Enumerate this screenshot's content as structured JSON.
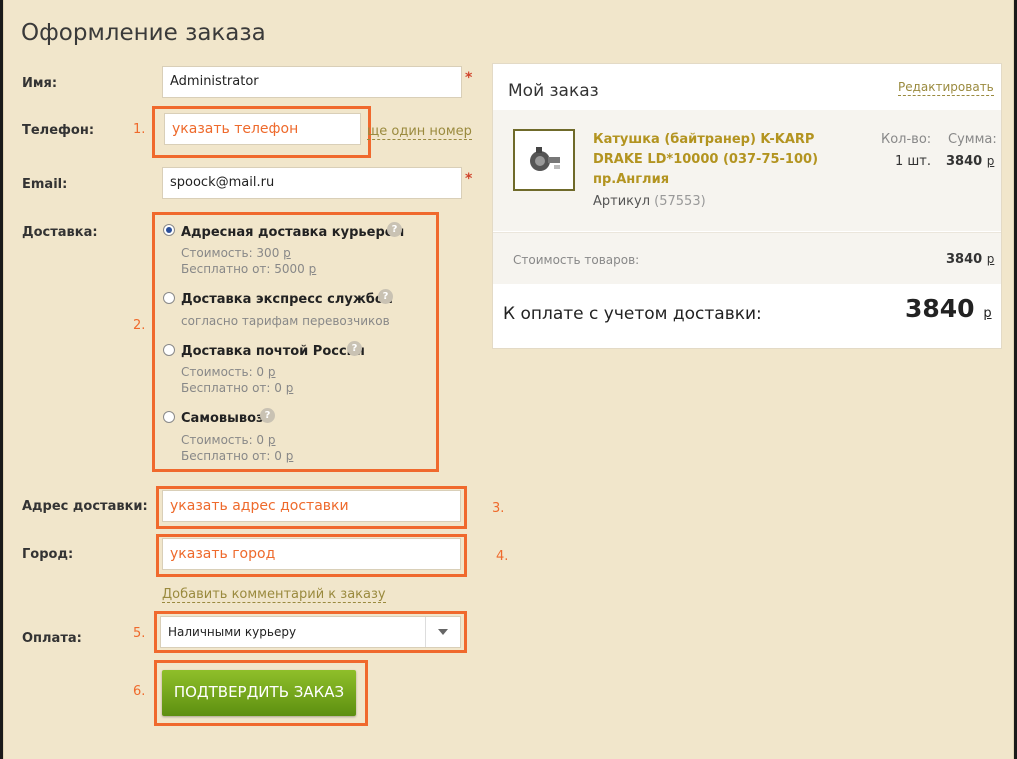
{
  "page_title": "Оформление заказа",
  "form": {
    "name_label": "Имя:",
    "name_value": "Administrator",
    "required_mark": "*",
    "phone_label": "Телефон:",
    "phone_placeholder": "указать телефон",
    "phone_extra_link": "ще один номер",
    "email_label": "Email:",
    "email_value": "spoock@mail.ru",
    "delivery_label": "Доставка:",
    "delivery_options": [
      {
        "title": "Адресная доставка курьером",
        "line1": "Стоимость: 300",
        "line2": "Бесплатно от: 5000",
        "selected": true
      },
      {
        "title": "Доставка экспресс службой",
        "line1": "согласно тарифам перевозчиков",
        "line2": "",
        "selected": false
      },
      {
        "title": "Доставка почтой России",
        "line1": "Стоимость: 0",
        "line2": "Бесплатно от: 0",
        "selected": false
      },
      {
        "title": "Самовывоз",
        "line1": "Стоимость: 0",
        "line2": "Бесплатно от: 0",
        "selected": false
      }
    ],
    "currency": "р",
    "address_label": "Адрес доставки:",
    "address_placeholder": "указать адрес доставки",
    "city_label": "Город:",
    "city_placeholder": "указать город",
    "comment_link": "Добавить комментарий к заказу",
    "payment_label": "Оплата:",
    "payment_selected": "Наличными курьеру",
    "submit_label": "ПОДТВЕРДИТЬ ЗАКАЗ"
  },
  "annotations": [
    "1.",
    "2.",
    "3.",
    "4.",
    "5.",
    "6."
  ],
  "order": {
    "title": "Мой заказ",
    "edit_link": "Редактировать",
    "item": {
      "name_line1": "Катушка (байтранер) K-KARP",
      "name_line2": "DRAKE LD*10000 (037-75-100)",
      "name_line3": "пр.Англия",
      "sku_label": "Артикул",
      "sku_value": "(57553)",
      "qty_label": "Кол-во:",
      "qty_value": "1 шт.",
      "sum_label": "Сумма:",
      "sum_value": "3840"
    },
    "goods_cost_label": "Стоимость товаров:",
    "goods_cost_value": "3840",
    "total_label": "К оплате с учетом доставки:",
    "total_value": "3840",
    "currency": "р"
  },
  "colors": {
    "page_bg": "#f1e6cb",
    "highlight": "#f0692d",
    "link": "#9a8a3e",
    "product_name": "#b39420",
    "button": "#6f9f18"
  }
}
